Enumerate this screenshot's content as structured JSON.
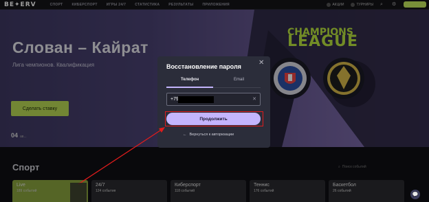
{
  "header": {
    "logo": "BE✦ERV",
    "nav": [
      "СПОРТ",
      "КИБЕРСПОРТ",
      "ИГРЫ 24/7",
      "СТАТИСТИКА",
      "РЕЗУЛЬТАТЫ",
      "ПРИЛОЖЕНИЯ"
    ],
    "promo": "АКЦИИ",
    "tournaments": "ТУРНИРЫ",
    "register_label": ""
  },
  "hero": {
    "title": "Слован – Кайрат",
    "subtitle": "Лига чемпионов. Квалификация",
    "bet_button": "Сделать ставку",
    "date": "04",
    "date_suffix": "ав...",
    "league_line1": "CHAMPIONS",
    "league_line2": "LEAGUE"
  },
  "sport": {
    "title": "Спорт",
    "search_placeholder": "Поиск событий",
    "cards": [
      {
        "name": "Live",
        "count": "189 событий"
      },
      {
        "name": "24/7",
        "count": "124 события"
      },
      {
        "name": "Киберспорт",
        "count": "118 событий"
      },
      {
        "name": "Теннис",
        "count": "176 событий"
      },
      {
        "name": "Баскетбол",
        "count": "26 событий"
      }
    ]
  },
  "modal": {
    "title": "Восстановление пароля",
    "tabs": [
      "Телефон",
      "Email"
    ],
    "phone_value": "+79",
    "continue_label": "Продолжить",
    "back_label": "Вернуться к авторизации"
  },
  "colors": {
    "accent": "#c4b5fd",
    "brand_green": "#b9d855",
    "highlight_red": "#e01c1c",
    "modal_bg": "#2b2d3a"
  }
}
